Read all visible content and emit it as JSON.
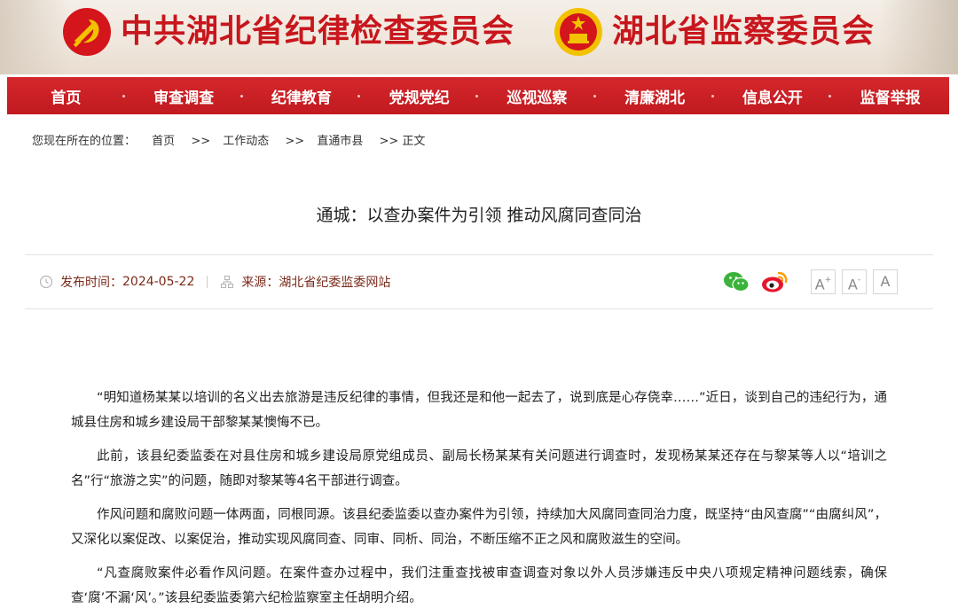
{
  "banner": {
    "cpc_title": "中共湖北省纪律检查委员会",
    "supervision_title": "湖北省监察委员会",
    "colors": {
      "brand_red": "#c8161d",
      "gold": "#f2c200"
    }
  },
  "nav": {
    "items": [
      {
        "label": "首页"
      },
      {
        "label": "审查调查"
      },
      {
        "label": "纪律教育"
      },
      {
        "label": "党规党纪"
      },
      {
        "label": "巡视巡察"
      },
      {
        "label": "清廉湖北"
      },
      {
        "label": "信息公开"
      },
      {
        "label": "监督举报"
      }
    ]
  },
  "breadcrumb": {
    "prefix": "您现在所在的位置：",
    "home": "首页",
    "sep": ">>",
    "level1": "工作动态",
    "level2": "直通市县",
    "current": ">> 正文"
  },
  "article": {
    "title": "通城：以查办案件为引领 推动风腐同查同治",
    "publish_label": "发布时间：",
    "publish_date": "2024-05-22",
    "source_label": "来源：",
    "source": "湖北省纪委监委网站",
    "share": {
      "wechat": "wechat-icon",
      "weibo": "weibo-icon"
    },
    "font_controls": {
      "enlarge": "A",
      "reset": "A",
      "shrink": "A"
    },
    "paragraphs": [
      "“明知道杨某某以培训的名义出去旅游是违反纪律的事情，但我还是和他一起去了，说到底是心存侥幸……”近日，谈到自己的违纪行为，通城县住房和城乡建设局干部黎某某懊悔不已。",
      "此前，该县纪委监委在对县住房和城乡建设局原党组成员、副局长杨某某有关问题进行调查时，发现杨某某还存在与黎某等人以“培训之名”行“旅游之实”的问题，随即对黎某等4名干部进行调查。",
      "作风问题和腐败问题一体两面，同根同源。该县纪委监委以查办案件为引领，持续加大风腐同查同治力度，既坚持“由风查腐”“由腐纠风”，又深化以案促改、以案促治，推动实现风腐同查、同审、同析、同治，不断压缩不正之风和腐败滋生的空间。",
      "“凡查腐败案件必看作风问题。在案件查办过程中，我们注重查找被审查调查对象以外人员涉嫌违反中央八项规定精神问题线索，确保查‘腐’不漏‘风’。”该县纪委监委第六纪检监察室主任胡明介绍。"
    ]
  }
}
